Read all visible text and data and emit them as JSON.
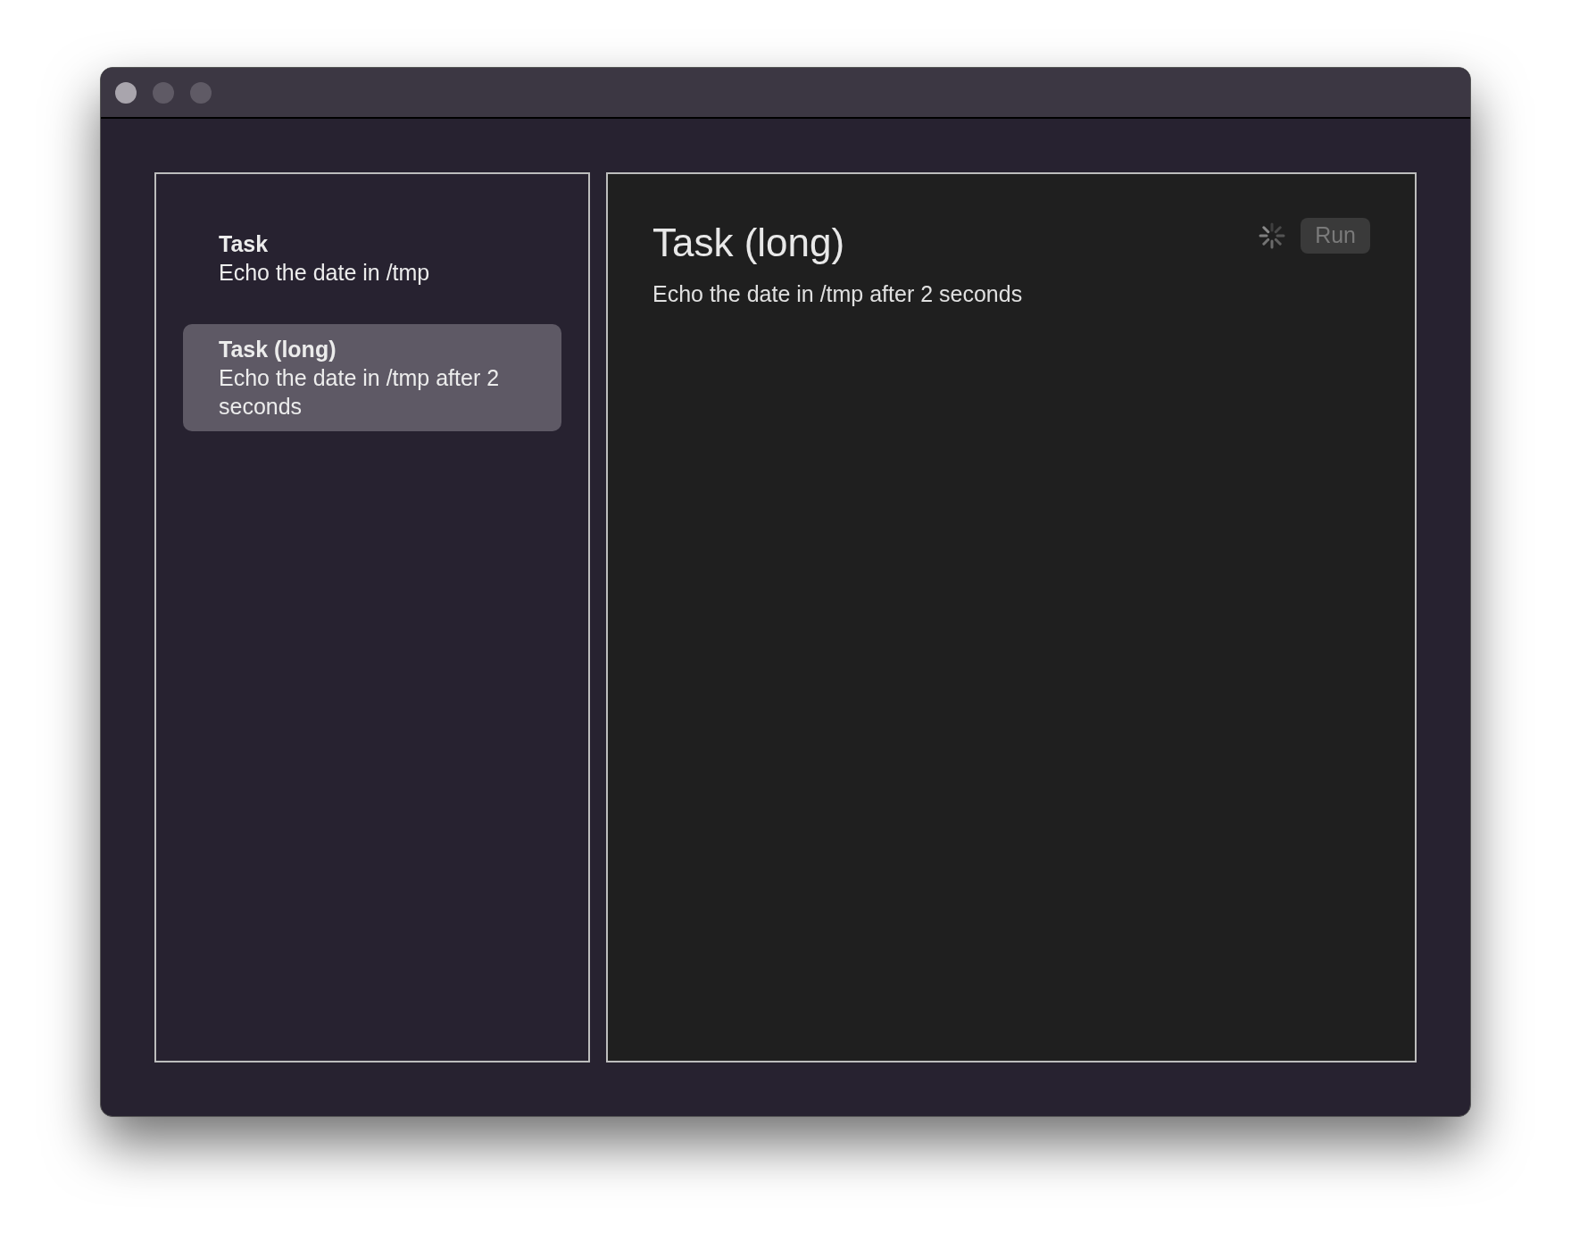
{
  "window": {
    "traffic_lights": [
      {
        "on": true
      },
      {
        "on": false
      },
      {
        "on": false
      }
    ]
  },
  "tasks": [
    {
      "title": "Task",
      "description": "Echo the date in /tmp",
      "selected": false
    },
    {
      "title": "Task (long)",
      "description": "Echo the date in /tmp after 2 seconds",
      "selected": true
    }
  ],
  "detail": {
    "title": "Task (long)",
    "description": "Echo the date in /tmp after 2 seconds",
    "running": true,
    "run_button": {
      "label": "Run",
      "disabled": true
    }
  }
}
